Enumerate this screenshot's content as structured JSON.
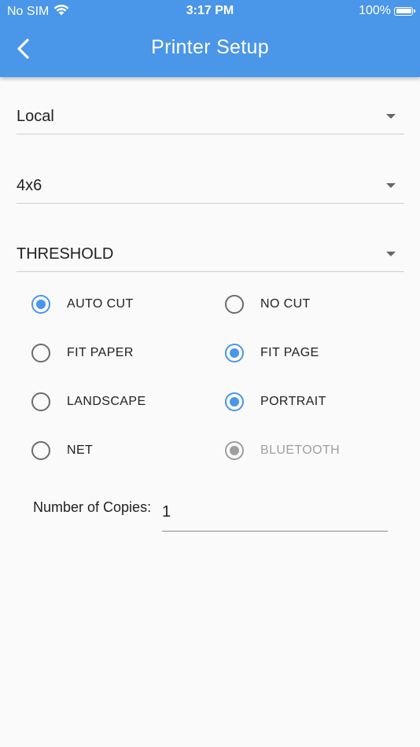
{
  "status_bar": {
    "carrier": "No SIM",
    "time": "3:17 PM",
    "battery": "100%"
  },
  "app_bar": {
    "title": "Printer Setup",
    "back_icon": "chevron-left-icon"
  },
  "dropdowns": [
    {
      "value": "Local"
    },
    {
      "value": "4x6"
    },
    {
      "value": "THRESHOLD"
    }
  ],
  "options": {
    "auto_cut": {
      "label": "AUTO CUT",
      "checked": true
    },
    "no_cut": {
      "label": "NO CUT",
      "checked": false
    },
    "fit_paper": {
      "label": "FIT PAPER",
      "checked": false
    },
    "fit_page": {
      "label": "FIT PAGE",
      "checked": true
    },
    "landscape": {
      "label": "LANDSCAPE",
      "checked": false
    },
    "portrait": {
      "label": "PORTRAIT",
      "checked": true
    },
    "net": {
      "label": "NET",
      "checked": false
    },
    "bluetooth": {
      "label": "BLUETOOTH",
      "checked": true,
      "disabled": true
    }
  },
  "copies": {
    "label": "Number of Copies:",
    "value": "1"
  },
  "colors": {
    "accent": "#4a96e8",
    "background": "#fafafa",
    "disabled": "#9e9e9e"
  }
}
